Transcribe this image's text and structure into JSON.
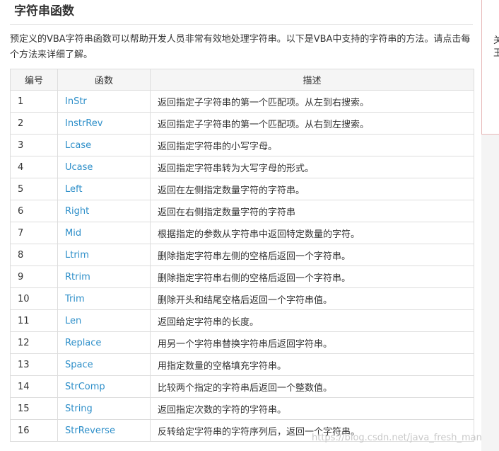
{
  "page": {
    "title": "字符串函数",
    "intro": "预定义的VBA字符串函数可以帮助开发人员非常有效地处理字符串。以下是VBA中支持的字符串的方法。请点击每个方法来详细了解。",
    "sidebar_text": "关\n王",
    "watermark": "https://blog.csdn.net/java_fresh_man"
  },
  "table": {
    "headers": [
      "编号",
      "函数",
      "描述"
    ],
    "rows": [
      {
        "num": "1",
        "fn": "InStr",
        "desc": "返回指定子字符串的第一个匹配项。从左到右搜索。"
      },
      {
        "num": "2",
        "fn": "InstrRev",
        "desc": "返回指定子字符串的第一个匹配项。从右到左搜索。"
      },
      {
        "num": "3",
        "fn": "Lcase",
        "desc": "返回指定字符串的小写字母。"
      },
      {
        "num": "4",
        "fn": "Ucase",
        "desc": "返回指定字符串转为大写字母的形式。"
      },
      {
        "num": "5",
        "fn": "Left",
        "desc": "返回在左侧指定数量字符的字符串。"
      },
      {
        "num": "6",
        "fn": "Right",
        "desc": "返回在右侧指定数量字符的字符串"
      },
      {
        "num": "7",
        "fn": "Mid",
        "desc": "根据指定的参数从字符串中返回特定数量的字符。"
      },
      {
        "num": "8",
        "fn": "Ltrim",
        "desc": "删除指定字符串左侧的空格后返回一个字符串。"
      },
      {
        "num": "9",
        "fn": "Rtrim",
        "desc": "删除指定字符串右侧的空格后返回一个字符串。"
      },
      {
        "num": "10",
        "fn": "Trim",
        "desc": "删除开头和结尾空格后返回一个字符串值。"
      },
      {
        "num": "11",
        "fn": "Len",
        "desc": "返回给定字符串的长度。"
      },
      {
        "num": "12",
        "fn": "Replace",
        "desc": "用另一个字符串替换字符串后返回字符串。"
      },
      {
        "num": "13",
        "fn": "Space",
        "desc": "用指定数量的空格填充字符串。"
      },
      {
        "num": "14",
        "fn": "StrComp",
        "desc": "比较两个指定的字符串后返回一个整数值。"
      },
      {
        "num": "15",
        "fn": "String",
        "desc": "返回指定次数的字符的字符串。"
      },
      {
        "num": "16",
        "fn": "StrReverse",
        "desc": "反转给定字符串的字符序列后，返回一个字符串。"
      }
    ]
  },
  "colors": {
    "link": "#2e8fc9",
    "header_bg": "#f5f5f5",
    "border": "#dddddd",
    "sidebar_border": "#e7b7b7"
  }
}
